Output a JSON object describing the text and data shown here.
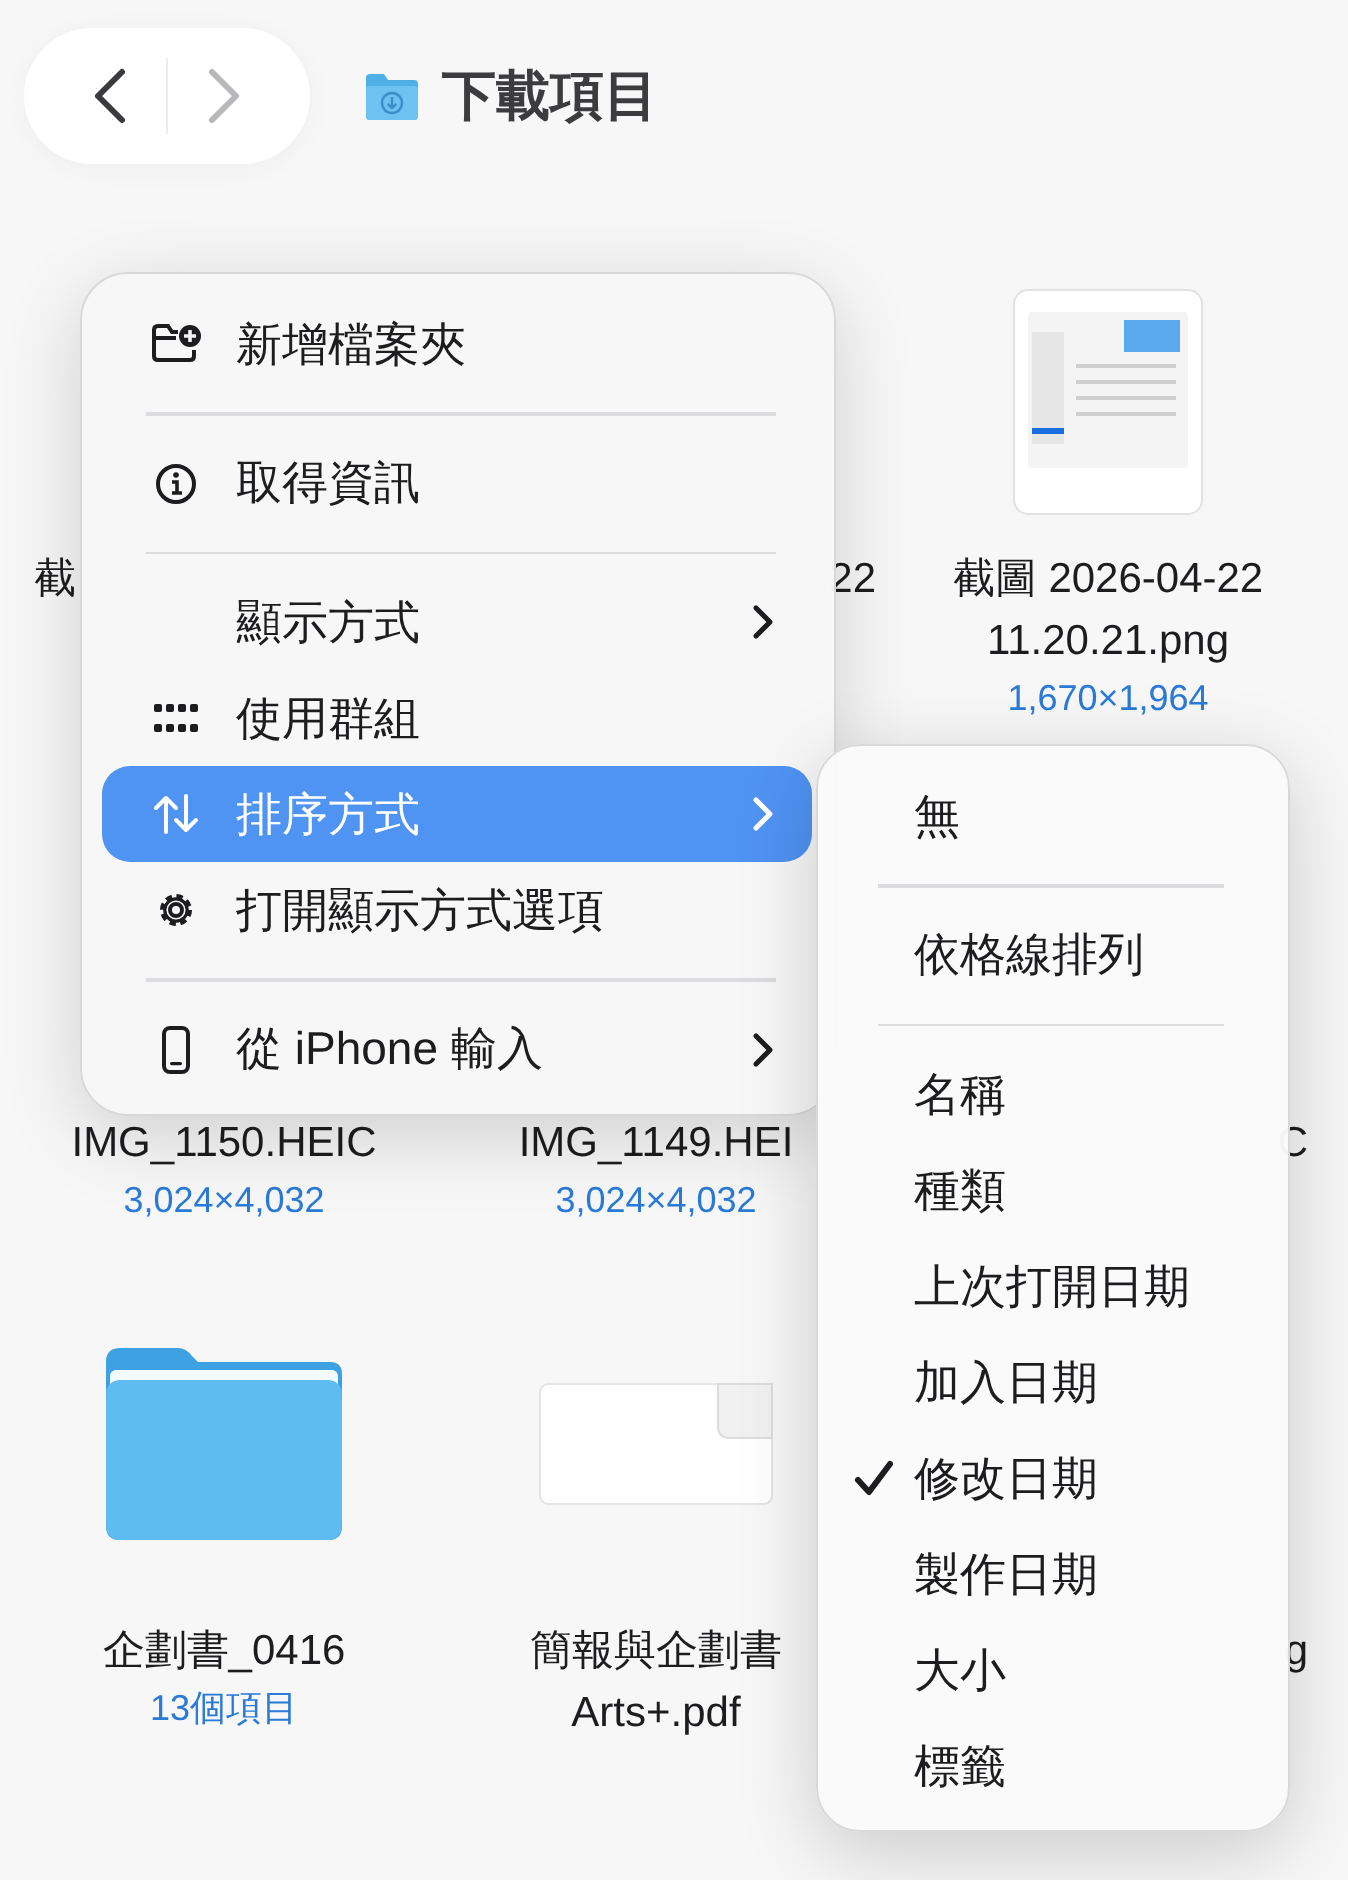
{
  "toolbar": {
    "back": {
      "disabled": false
    },
    "forward": {
      "disabled": true
    },
    "title": "下載項目"
  },
  "files": [
    {
      "kind": "hidden",
      "name_lines": [
        "截"
      ]
    },
    {
      "kind": "hidden",
      "name_lines": [
        "22"
      ]
    },
    {
      "kind": "screenshot",
      "name_lines": [
        "截圖 2026-04-22",
        "11.20.21.png"
      ],
      "detail": "1,670×1,964"
    },
    {
      "kind": "hidden",
      "name_lines": [
        "IMG_1150.HEIC"
      ],
      "detail": "3,024×4,032"
    },
    {
      "kind": "hidden",
      "name_lines": [
        "IMG_1149.HEI"
      ],
      "detail": "3,024×4,032"
    },
    {
      "kind": "hidden",
      "name_lines": [
        "C"
      ]
    },
    {
      "kind": "folder",
      "name_lines": [
        "企劃書_0416"
      ],
      "detail": "13個項目"
    },
    {
      "kind": "pdf",
      "name_lines": [
        "簡報與企劃書",
        "Arts+.pdf"
      ]
    },
    {
      "kind": "hidden",
      "name_lines": [
        "g"
      ]
    }
  ],
  "context_menu": {
    "items": [
      {
        "kind": "item",
        "label": "新增檔案夾",
        "submenu": false,
        "selected": false
      },
      {
        "kind": "divider"
      },
      {
        "kind": "item",
        "label": "取得資訊",
        "submenu": false,
        "selected": false
      },
      {
        "kind": "divider"
      },
      {
        "kind": "item",
        "label": "顯示方式",
        "submenu": true,
        "selected": false
      },
      {
        "kind": "item",
        "label": "使用群組",
        "submenu": false,
        "selected": false
      },
      {
        "kind": "item",
        "label": "排序方式",
        "submenu": true,
        "selected": true
      },
      {
        "kind": "item",
        "label": "打開顯示方式選項",
        "submenu": false,
        "selected": false
      },
      {
        "kind": "divider"
      },
      {
        "kind": "item",
        "label": "從 iPhone 輸入",
        "submenu": true,
        "selected": false
      }
    ]
  },
  "sort_submenu": {
    "items": [
      {
        "kind": "item",
        "label": "無",
        "checked": false
      },
      {
        "kind": "divider"
      },
      {
        "kind": "item",
        "label": "依格線排列",
        "checked": false
      },
      {
        "kind": "divider"
      },
      {
        "kind": "item",
        "label": "名稱",
        "checked": false
      },
      {
        "kind": "item",
        "label": "種類",
        "checked": false
      },
      {
        "kind": "item",
        "label": "上次打開日期",
        "checked": false
      },
      {
        "kind": "item",
        "label": "加入日期",
        "checked": false
      },
      {
        "kind": "item",
        "label": "修改日期",
        "checked": true
      },
      {
        "kind": "item",
        "label": "製作日期",
        "checked": false
      },
      {
        "kind": "item",
        "label": "大小",
        "checked": false
      },
      {
        "kind": "item",
        "label": "標籤",
        "checked": false
      }
    ]
  }
}
